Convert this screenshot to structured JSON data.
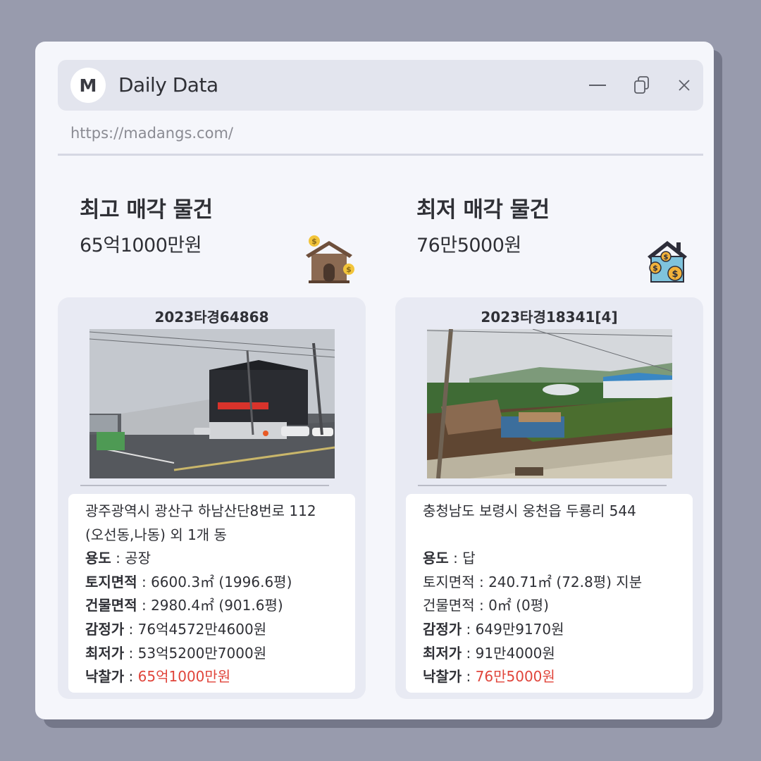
{
  "window": {
    "logo_letter": "M",
    "title": "Daily Data",
    "url": "https://madangs.com/",
    "colors": {
      "background": "#989bad",
      "window": "#f5f6fb",
      "titlebar": "#e3e5ee",
      "card": "#e8eaf3",
      "highlight": "#e0453b"
    },
    "icons": [
      "minimize-icon",
      "copy-icon",
      "close-icon"
    ]
  },
  "highest": {
    "heading": "최고 매각 물건",
    "price": "65억1000만원",
    "icon": "house-money-icon",
    "case_no": "2023타경64868",
    "address_line1": "광주광역시 광산구 하남산단8번로 112",
    "address_line2": "(오선동,나동) 외 1개 동",
    "usage_label": "용도",
    "usage_value": " : 공장",
    "land_label": "토지면적",
    "land_value": " : 6600.3㎡ (1996.6평)",
    "building_label": "건물면적",
    "building_value": " : 2980.4㎡ (901.6평)",
    "appraisal_label": "감정가",
    "appraisal_value": " : 76억4572만4600원",
    "minimum_label": "최저가",
    "minimum_value": " : 53억5200만7000원",
    "winning_label": "낙찰가",
    "winning_sep": " : ",
    "winning_value": "65억1000만원"
  },
  "lowest": {
    "heading": "최저 매각 물건",
    "price": "76만5000원",
    "icon": "house-coins-icon",
    "case_no": "2023타경18341[4]",
    "address_line1": "충청남도 보령시 웅천읍 두룡리 544",
    "usage_label": "용도",
    "usage_value": " : 답",
    "land_label": "토지면적",
    "land_value": " : 240.71㎡ (72.8평) 지분",
    "building_label": "건물면적",
    "building_value": " : 0㎡ (0평)",
    "appraisal_label": "감정가",
    "appraisal_value": " : 649만9170원",
    "minimum_label": "최저가",
    "minimum_value": " : 91만4000원",
    "winning_label": "낙찰가",
    "winning_sep": " : ",
    "winning_value": "76만5000원"
  }
}
